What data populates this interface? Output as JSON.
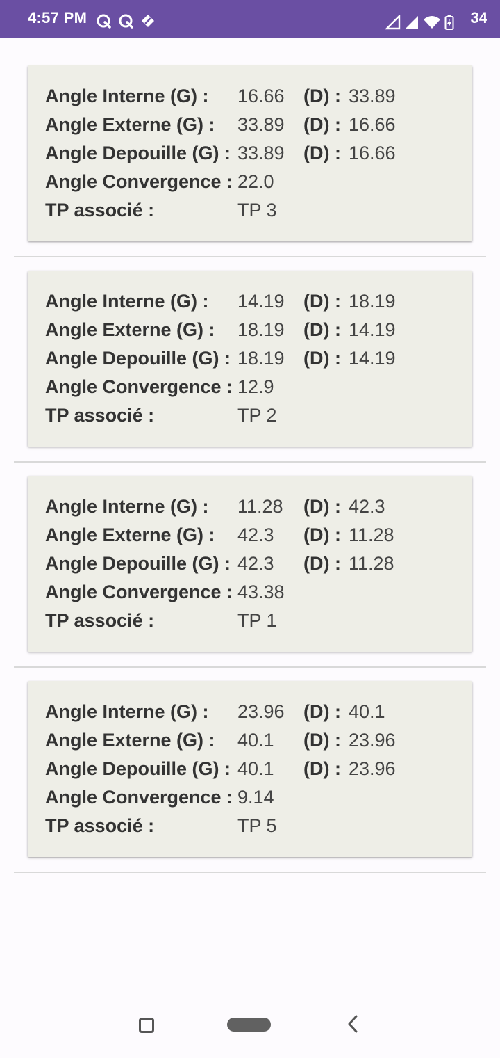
{
  "status_bar": {
    "time": "4:57 PM",
    "left_icons": [
      "q-app-icon",
      "q-app-icon",
      "pen-badge-icon"
    ],
    "right_icons": [
      "signal-icon",
      "signal-icon",
      "wifi-icon",
      "battery-charging-icon"
    ],
    "battery_level": "34",
    "background_color": "#6a4fa3"
  },
  "labels": {
    "interne": "Angle Interne (G) :",
    "externe": "Angle Externe (G) :",
    "depouille": "Angle Depouille (G) :",
    "convergence": "Angle Convergence :",
    "tp": "TP associé :",
    "droite": "(D) :"
  },
  "cards": [
    {
      "interne_g": "16.66",
      "interne_d": "33.89",
      "externe_g": "33.89",
      "externe_d": "16.66",
      "depouille_g": "33.89",
      "depouille_d": "16.66",
      "convergence": "22.0",
      "tp": "TP 3"
    },
    {
      "interne_g": "14.19",
      "interne_d": "18.19",
      "externe_g": "18.19",
      "externe_d": "14.19",
      "depouille_g": "18.19",
      "depouille_d": "14.19",
      "convergence": "12.9",
      "tp": "TP 2"
    },
    {
      "interne_g": "11.28",
      "interne_d": "42.3",
      "externe_g": "42.3",
      "externe_d": "11.28",
      "depouille_g": "42.3",
      "depouille_d": "11.28",
      "convergence": "43.38",
      "tp": "TP 1"
    },
    {
      "interne_g": "23.96",
      "interne_d": "40.1",
      "externe_g": "40.1",
      "externe_d": "23.96",
      "depouille_g": "40.1",
      "depouille_d": "23.96",
      "convergence": "9.14",
      "tp": "TP 5"
    }
  ],
  "nav_bar": {
    "icons": [
      "recents-icon",
      "home-pill-icon",
      "back-chevron-icon"
    ]
  }
}
